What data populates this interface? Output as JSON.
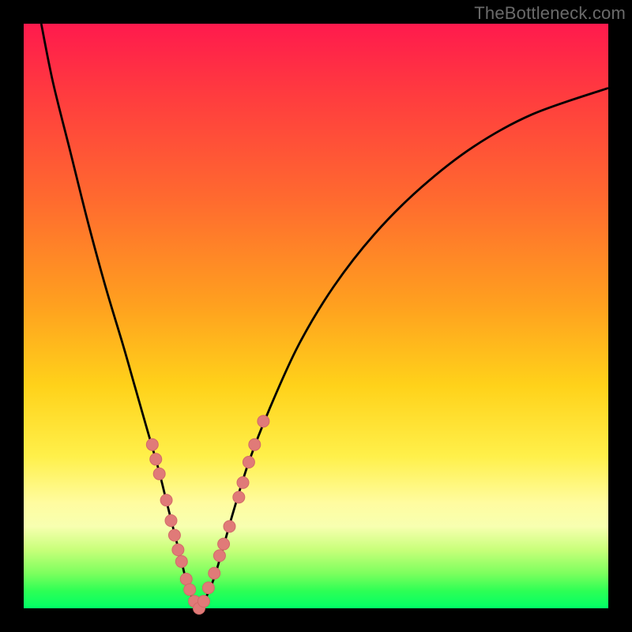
{
  "watermark": "TheBottleneck.com",
  "colors": {
    "frame": "#000000",
    "curve": "#000000",
    "marker_fill": "#e07a78",
    "marker_stroke": "#d26a68"
  },
  "chart_data": {
    "type": "line",
    "title": "",
    "xlabel": "",
    "ylabel": "",
    "xlim": [
      0,
      100
    ],
    "ylim": [
      0,
      100
    ],
    "grid": false,
    "series": [
      {
        "name": "bottleneck-curve",
        "x": [
          3,
          5,
          8,
          11,
          14,
          17,
          19,
          21,
          23,
          24.5,
          26,
          27,
          28,
          29,
          30,
          31,
          32.5,
          34,
          36,
          38.5,
          42,
          47,
          53,
          60,
          68,
          77,
          87,
          100
        ],
        "y": [
          100,
          90,
          78,
          66,
          55,
          45,
          38,
          31,
          24,
          18,
          12,
          8,
          4,
          1.5,
          0,
          1.5,
          5,
          10,
          17,
          25,
          34,
          45,
          55,
          64,
          72,
          79,
          84.5,
          89
        ]
      }
    ],
    "markers": [
      {
        "x": 22.0,
        "y": 28.0
      },
      {
        "x": 22.6,
        "y": 25.5
      },
      {
        "x": 23.2,
        "y": 23.0
      },
      {
        "x": 24.4,
        "y": 18.5
      },
      {
        "x": 25.2,
        "y": 15.0
      },
      {
        "x": 25.8,
        "y": 12.5
      },
      {
        "x": 26.4,
        "y": 10.0
      },
      {
        "x": 27.0,
        "y": 8.0
      },
      {
        "x": 27.8,
        "y": 5.0
      },
      {
        "x": 28.4,
        "y": 3.2
      },
      {
        "x": 29.2,
        "y": 1.2
      },
      {
        "x": 30.0,
        "y": 0.0
      },
      {
        "x": 30.8,
        "y": 1.2
      },
      {
        "x": 31.6,
        "y": 3.5
      },
      {
        "x": 32.6,
        "y": 6.0
      },
      {
        "x": 33.5,
        "y": 9.0
      },
      {
        "x": 34.2,
        "y": 11.0
      },
      {
        "x": 35.2,
        "y": 14.0
      },
      {
        "x": 36.8,
        "y": 19.0
      },
      {
        "x": 37.5,
        "y": 21.5
      },
      {
        "x": 38.5,
        "y": 25.0
      },
      {
        "x": 39.5,
        "y": 28.0
      },
      {
        "x": 41.0,
        "y": 32.0
      }
    ]
  }
}
